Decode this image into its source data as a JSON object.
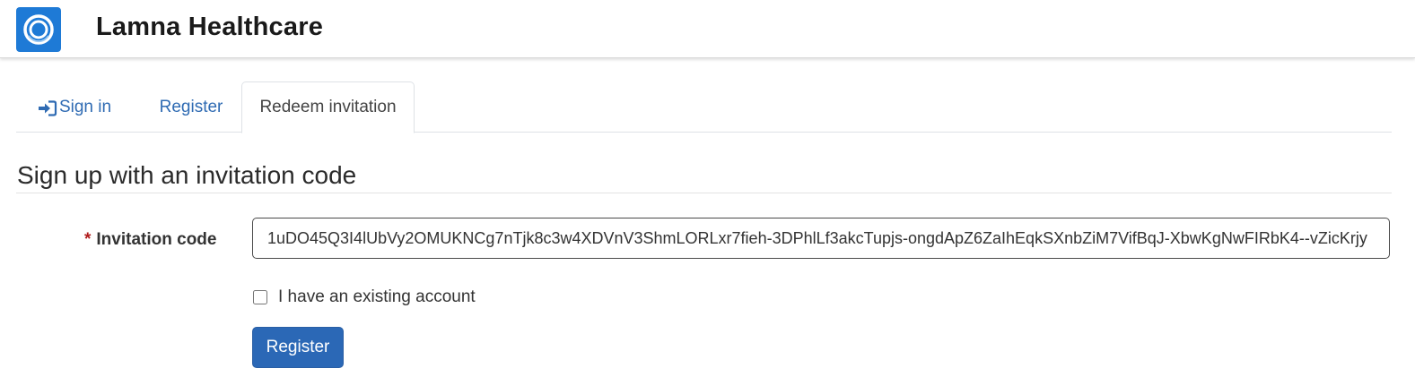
{
  "header": {
    "brand_name": "Lamna Healthcare",
    "logo_icon": "ring-logo-icon",
    "logo_color": "#1e7ad6"
  },
  "tabs": [
    {
      "label": "Sign in",
      "icon": "sign-in-icon",
      "active": false
    },
    {
      "label": "Register",
      "active": false
    },
    {
      "label": "Redeem invitation",
      "active": true
    }
  ],
  "main": {
    "heading": "Sign up with an invitation code",
    "invitation_field": {
      "required_marker": "*",
      "label": "Invitation code",
      "value": "1uDO45Q3I4lUbVy2OMUKNCg7nTjk8c3w4XDVnV3ShmLORLxr7fieh-3DPhlLf3akcTupjs-ongdApZ6ZaIhEqkSXnbZiM7VifBqJ-XbwKgNwFIRbK4--vZicKrjy"
    },
    "existing_account_checkbox": {
      "label": "I have an existing account",
      "checked": false
    },
    "submit_label": "Register"
  },
  "colors": {
    "link": "#2f6bb3",
    "primary_button": "#2b68b6",
    "required": "#b01c1c"
  }
}
